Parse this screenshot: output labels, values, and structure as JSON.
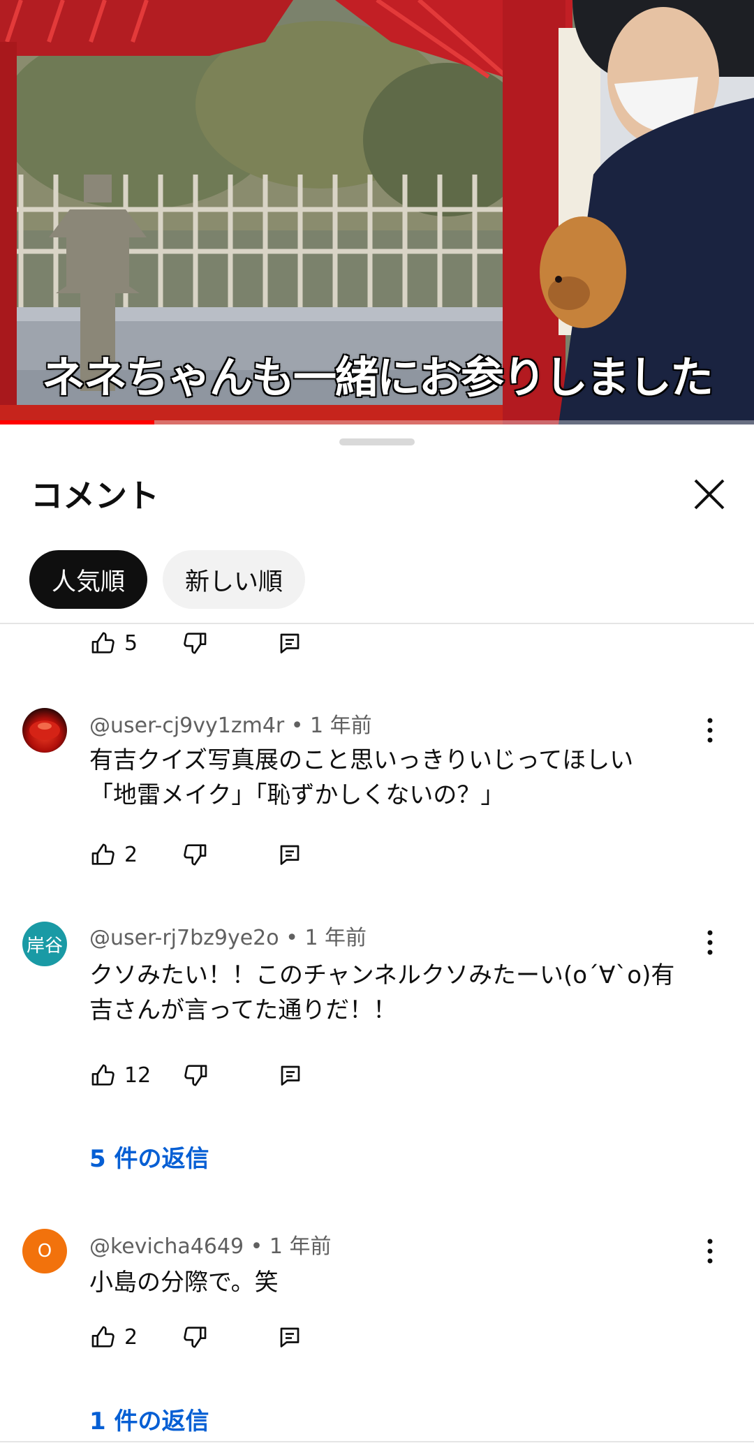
{
  "video": {
    "caption": "ネネちゃんも一緒にお参りしました",
    "progress": 0.205
  },
  "sheet": {
    "title": "コメント",
    "close_icon": "close-icon",
    "sort_chips": [
      {
        "label": "人気順",
        "active": true
      },
      {
        "label": "新しい順",
        "active": false
      }
    ]
  },
  "comments": [
    {
      "like_count": "5"
    },
    {
      "handle": "@user-cj9vy1zm4r",
      "age": "1 年前",
      "text_lines": [
        "有吉クイズ写真展のこと思いっきりいじってほしい",
        "「地雷メイク」「恥ずかしくないの？」"
      ],
      "like_count": "2",
      "avatar": {
        "type": "image",
        "color": "#c0150c"
      }
    },
    {
      "handle": "@user-rj7bz9ye2o",
      "age": "1 年前",
      "text_lines": [
        "クソみたい！！このチャンネルクソみたーい(o´∀`o)有",
        "吉さんが言ってた通りだ！！"
      ],
      "like_count": "12",
      "avatar": {
        "type": "text",
        "label": "岸谷",
        "color": "#1a9aa5"
      },
      "replies": "5 件の返信"
    },
    {
      "handle": "@kevicha4649",
      "age": "1 年前",
      "text_lines": [
        "小島の分際で。笑"
      ],
      "like_count": "2",
      "avatar": {
        "type": "text",
        "label": "O",
        "color": "#f2720c"
      },
      "replies": "1 件の返信"
    }
  ],
  "separator": "•",
  "accent_colors": {
    "link": "#065fd4",
    "progress": "#ff0000"
  }
}
